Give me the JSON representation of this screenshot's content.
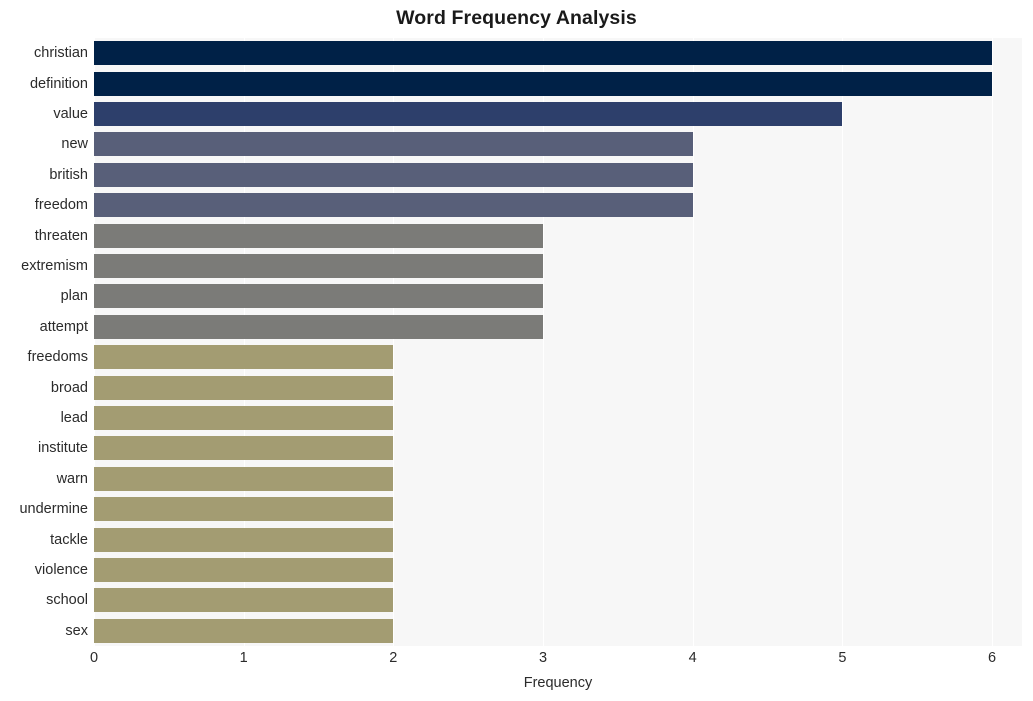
{
  "chart_data": {
    "type": "bar",
    "orientation": "horizontal",
    "title": "Word Frequency Analysis",
    "xlabel": "Frequency",
    "ylabel": "",
    "xlim": [
      0,
      6.2
    ],
    "xticks": [
      0,
      1,
      2,
      3,
      4,
      5,
      6
    ],
    "xticklabels": [
      "0",
      "1",
      "2",
      "3",
      "4",
      "5",
      "6"
    ],
    "grid": true,
    "grid_axis": "x",
    "legend": null,
    "categories": [
      "christian",
      "definition",
      "value",
      "new",
      "british",
      "freedom",
      "threaten",
      "extremism",
      "plan",
      "attempt",
      "freedoms",
      "broad",
      "lead",
      "institute",
      "warn",
      "undermine",
      "tackle",
      "violence",
      "school",
      "sex"
    ],
    "values": [
      6,
      6,
      5,
      4,
      4,
      4,
      3,
      3,
      3,
      3,
      2,
      2,
      2,
      2,
      2,
      2,
      2,
      2,
      2,
      2
    ],
    "bar_colors": [
      "#002147",
      "#002147",
      "#2d3f6b",
      "#585f79",
      "#585f79",
      "#585f79",
      "#7b7b78",
      "#7b7b78",
      "#7b7b78",
      "#7b7b78",
      "#a39c72",
      "#a39c72",
      "#a39c72",
      "#a39c72",
      "#a39c72",
      "#a39c72",
      "#a39c72",
      "#a39c72",
      "#a39c72",
      "#a39c72"
    ],
    "plot_background": "#f7f7f7",
    "grid_color": "#ffffff",
    "figure_background": "#ffffff"
  }
}
